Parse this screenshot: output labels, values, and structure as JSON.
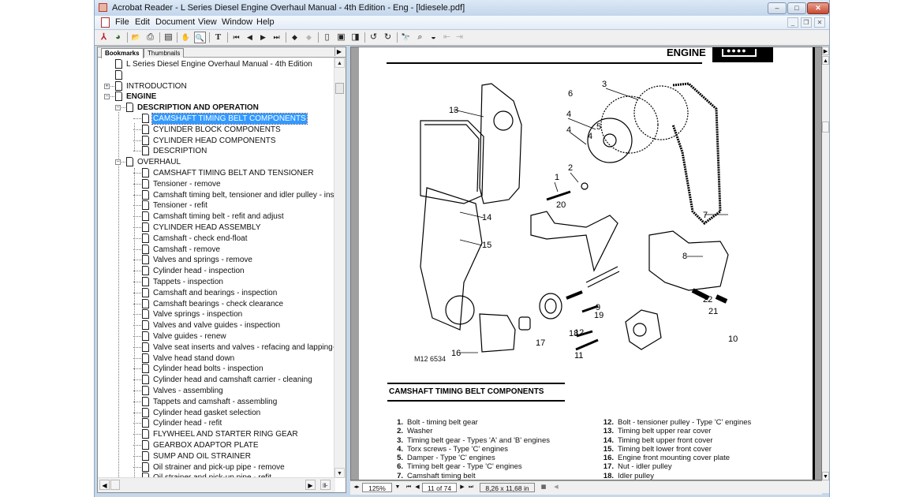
{
  "window": {
    "title": "Acrobat Reader - L Series Diesel Engine Overhaul Manual - 4th Edition - Eng - [ldiesele.pdf]",
    "controls": {
      "minimize": "–",
      "maximize": "□",
      "close": "✕"
    },
    "mdi_controls": {
      "minimize": "_",
      "restore": "❐",
      "close": "✕"
    }
  },
  "menu": [
    "File",
    "Edit",
    "Document",
    "View",
    "Window",
    "Help"
  ],
  "toolbar": [
    {
      "name": "acrobat-logo-icon",
      "glyph": "⅄"
    },
    {
      "name": "web-capture-icon",
      "glyph": "◕"
    },
    {
      "name": "open-icon",
      "glyph": "📂"
    },
    {
      "name": "print-icon",
      "glyph": "⎙"
    },
    {
      "name": "show-navigation-pane-icon",
      "glyph": "▤"
    },
    {
      "name": "hand-tool-icon",
      "glyph": "✋"
    },
    {
      "name": "zoom-tool-icon",
      "glyph": "🔍"
    },
    {
      "name": "text-select-icon",
      "glyph": "T"
    },
    {
      "name": "first-page-icon",
      "glyph": "⏮"
    },
    {
      "name": "previous-page-icon",
      "glyph": "◀"
    },
    {
      "name": "next-page-icon",
      "glyph": "▶"
    },
    {
      "name": "last-page-icon",
      "glyph": "⏭"
    },
    {
      "name": "go-back-icon",
      "glyph": "◆"
    },
    {
      "name": "go-forward-icon",
      "glyph": "◆"
    },
    {
      "name": "actual-size-icon",
      "glyph": "▯"
    },
    {
      "name": "fit-page-icon",
      "glyph": "▣"
    },
    {
      "name": "fit-width-icon",
      "glyph": "◨"
    },
    {
      "name": "rotate-left-icon",
      "glyph": "↺"
    },
    {
      "name": "rotate-right-icon",
      "glyph": "↻"
    },
    {
      "name": "find-icon",
      "glyph": "🔭"
    },
    {
      "name": "search-icon",
      "glyph": "⌕"
    },
    {
      "name": "search-results-icon",
      "glyph": "◒"
    },
    {
      "name": "previous-highlight-icon",
      "glyph": "⇤"
    },
    {
      "name": "next-highlight-icon",
      "glyph": "⇥"
    }
  ],
  "navigation_pane": {
    "tabs": [
      "Bookmarks",
      "Thumbnails"
    ],
    "active_tab": "Bookmarks",
    "options_arrow": "▶",
    "bookmarks": [
      {
        "label": "L Series Diesel Engine Overhaul Manual - 4th Edition",
        "level": 0
      },
      {
        "label": "",
        "level": 0
      },
      {
        "label": "INTRODUCTION",
        "level": 0,
        "expander": "+"
      },
      {
        "label": "ENGINE",
        "level": 0,
        "expander": "−",
        "bold": true
      },
      {
        "label": "DESCRIPTION AND OPERATION",
        "level": 1,
        "expander": "−",
        "bold": true
      },
      {
        "label": "CAMSHAFT TIMING BELT COMPONENTS",
        "level": 2,
        "selected": true
      },
      {
        "label": "CYLINDER BLOCK COMPONENTS",
        "level": 2
      },
      {
        "label": "CYLINDER HEAD COMPONENTS",
        "level": 2
      },
      {
        "label": "DESCRIPTION",
        "level": 2
      },
      {
        "label": "OVERHAUL",
        "level": 1,
        "expander": "−"
      },
      {
        "label": "CAMSHAFT TIMING BELT AND TENSIONER",
        "level": 2
      },
      {
        "label": "Tensioner - remove",
        "level": 2
      },
      {
        "label": "Camshaft timing belt, tensioner and idler pulley - inspect",
        "level": 2
      },
      {
        "label": "Tensioner - refit",
        "level": 2
      },
      {
        "label": "Camshaft timing belt - refit and adjust",
        "level": 2
      },
      {
        "label": "CYLINDER HEAD ASSEMBLY",
        "level": 2
      },
      {
        "label": "Camshaft - check end-float",
        "level": 2
      },
      {
        "label": "Camshaft - remove",
        "level": 2
      },
      {
        "label": "Valves and springs - remove",
        "level": 2
      },
      {
        "label": "Cylinder head - inspection",
        "level": 2
      },
      {
        "label": "Tappets - inspection",
        "level": 2
      },
      {
        "label": "Camshaft and bearings - inspection",
        "level": 2
      },
      {
        "label": "Camshaft bearings - check clearance",
        "level": 2
      },
      {
        "label": "Valve springs - inspection",
        "level": 2
      },
      {
        "label": "Valves and valve guides - inspection",
        "level": 2
      },
      {
        "label": "Valve guides - renew",
        "level": 2
      },
      {
        "label": "Valve seat inserts and valves - refacing and lapping-in",
        "level": 2
      },
      {
        "label": "Valve head stand down",
        "level": 2
      },
      {
        "label": "Cylinder head bolts - inspection",
        "level": 2
      },
      {
        "label": "Cylinder head and camshaft carrier - cleaning",
        "level": 2
      },
      {
        "label": "Valves - assembling",
        "level": 2
      },
      {
        "label": "Tappets and camshaft - assembling",
        "level": 2
      },
      {
        "label": "Cylinder head gasket selection",
        "level": 2
      },
      {
        "label": "Cylinder head - refit",
        "level": 2
      },
      {
        "label": "FLYWHEEL AND STARTER RING GEAR",
        "level": 2
      },
      {
        "label": "GEARBOX ADAPTOR PLATE",
        "level": 2
      },
      {
        "label": "SUMP AND OIL STRAINER",
        "level": 2
      },
      {
        "label": "Oil strainer and pick-up pipe - remove",
        "level": 2
      },
      {
        "label": "Oil strainer and pick-up pipe - refit",
        "level": 2
      }
    ]
  },
  "document": {
    "section_header": "ENGINE",
    "figure_reference": "M12 6534",
    "callouts": [
      "1",
      "2",
      "3",
      "4",
      "4",
      "4",
      "5",
      "6",
      "7",
      "8",
      "9",
      "10",
      "11",
      "12",
      "13",
      "14",
      "15",
      "16",
      "17",
      "18",
      "19",
      "20",
      "21",
      "22"
    ],
    "section_title": "CAMSHAFT TIMING BELT COMPONENTS",
    "parts_left": [
      {
        "num": "1.",
        "text": "Bolt - timing belt gear"
      },
      {
        "num": "2.",
        "text": "Washer"
      },
      {
        "num": "3.",
        "text": "Timing belt gear - Types 'A' and 'B' engines"
      },
      {
        "num": "4.",
        "text": "Torx screws - Type 'C' engines"
      },
      {
        "num": "5.",
        "text": "Damper - Type 'C' engines"
      },
      {
        "num": "6.",
        "text": "Timing belt gear - Type 'C' engines"
      },
      {
        "num": "7.",
        "text": "Camshaft timing belt"
      }
    ],
    "parts_right": [
      {
        "num": "12.",
        "text": "Bolt - tensioner pulley - Type 'C' engines"
      },
      {
        "num": "13.",
        "text": "Timing belt upper rear cover"
      },
      {
        "num": "14.",
        "text": "Timing belt upper front cover"
      },
      {
        "num": "15.",
        "text": "Timing belt lower front cover"
      },
      {
        "num": "16.",
        "text": "Engine front mounting cover plate"
      },
      {
        "num": "17.",
        "text": "Nut - idler pulley"
      },
      {
        "num": "18.",
        "text": "Idler pulley"
      }
    ]
  },
  "statusbar": {
    "zoom": "125%",
    "page": "11 of 74",
    "page_size": "8,26 x 11,68 in"
  }
}
